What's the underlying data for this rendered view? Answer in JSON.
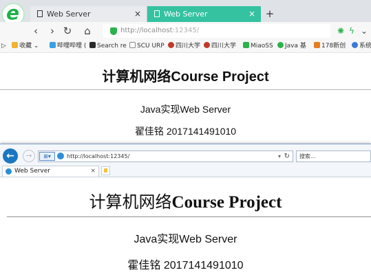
{
  "browser_top": {
    "tabs": [
      {
        "title": "Web Server",
        "close": "×"
      },
      {
        "title": "Web Server",
        "close": "×"
      }
    ],
    "new_tab": "+",
    "nav": {
      "back": "‹",
      "forward": "›",
      "reload": "↻",
      "home": "⌂"
    },
    "url_host": "http://localhost",
    "url_port": ":12345/",
    "bookmarks": [
      {
        "label": "收藏",
        "color": "#f2b233"
      },
      {
        "label": "哔哩哔哩 (",
        "color": "#3aa0e4"
      },
      {
        "label": "Search re",
        "color": "#2a2a2a"
      },
      {
        "label": "SCU URP",
        "color": "#ffffff"
      },
      {
        "label": "四川大学",
        "color": "#c0392b"
      },
      {
        "label": "四川大学",
        "color": "#c0392b"
      },
      {
        "label": "MiaoSS",
        "color": "#2bb24c"
      },
      {
        "label": "Java 基",
        "color": "#2bb24c"
      },
      {
        "label": "178新创",
        "color": "#e67e22"
      },
      {
        "label": "系统",
        "color": "#3a7bd5"
      }
    ],
    "page": {
      "heading": "计算机网络Course Project",
      "line1": "Java实现Web Server",
      "line2": "翟佳铭 2017141491010"
    },
    "accent_color": "#34c2a0"
  },
  "browser_bottom": {
    "address": "http://localhost:12345/",
    "search_placeholder": "搜索...",
    "tab_title": "Web Server",
    "tab_close": "×",
    "page": {
      "heading_cn": "计算机网络",
      "heading_en": "Course Project",
      "line1": "Java实现Web Server",
      "line2": "霍佳铭 2017141491010"
    }
  }
}
